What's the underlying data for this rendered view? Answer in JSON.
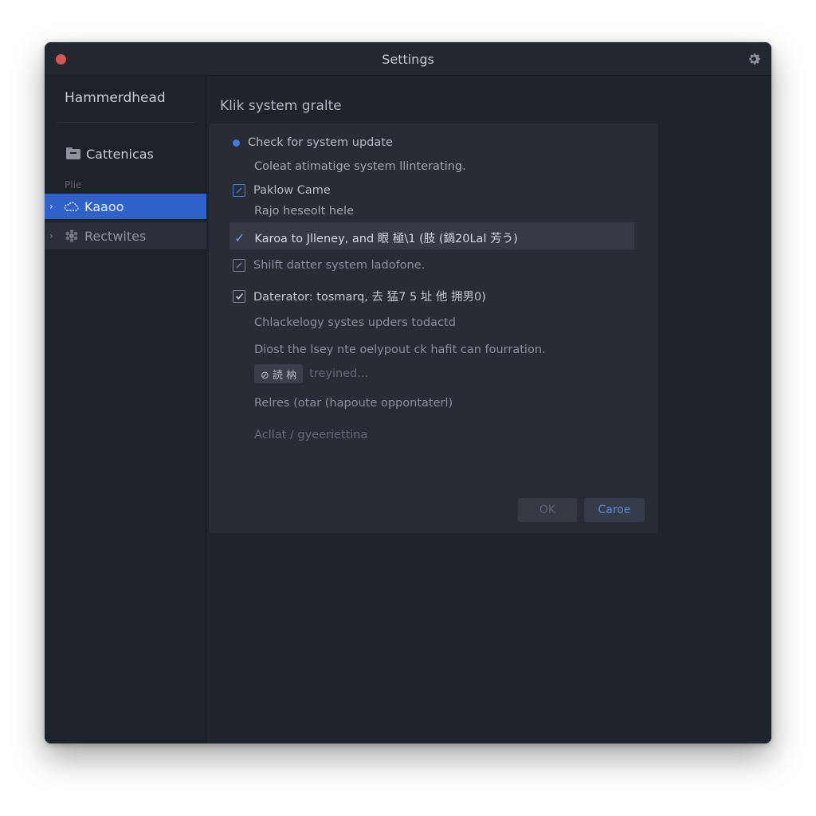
{
  "window": {
    "title": "Settings"
  },
  "sidebar": {
    "brand": "Hammerdhead",
    "category": "Cattenicas",
    "small_label": "Plie",
    "items": [
      {
        "label": "Kaaoo",
        "active": true
      },
      {
        "label": "Rectwites",
        "active": false
      }
    ]
  },
  "main": {
    "heading": "Klik system gralte",
    "rows": [
      {
        "text": "Check for system update",
        "marker": "dot"
      },
      {
        "text": "Coleat atimatige system llinterating."
      },
      {
        "text": "Paklow Came",
        "marker": "checkbox-blue"
      },
      {
        "text": "Rajo heseolt hele"
      },
      {
        "text": "Karoa to Jlleney, and 眼 極\\1 (肢 (鍋20Lal 芳う)",
        "marker": "tick",
        "selected": true
      },
      {
        "text": "Shilft datter system ladofone.",
        "marker": "checkbox"
      },
      {
        "text": "Daterator: tosmarq, 去 猛7 5 址 他 拥男0)",
        "marker": "checkbox-checked"
      },
      {
        "text": "Chlackelogy systes upders todactd"
      },
      {
        "text": "Diost the lsey nte oelypout ck hafit can fourration."
      },
      {
        "chip": "⊘ 読 枘",
        "text": "treyined..."
      },
      {
        "text": "Relres (otar (hapoute oppontaterl)"
      },
      {
        "text": "Acllat / gyeeriettina"
      }
    ],
    "ok_label": "OK",
    "cancel_label": "Caroe"
  },
  "colors": {
    "window_bg": "#1f232c",
    "accent": "#2f62c8",
    "close_dot": "#d5574f"
  },
  "icons": {
    "close": "close-dot-icon",
    "settings": "gear-icon",
    "category": "folder-icon",
    "active_item": "dashed-cloud-icon",
    "next_item": "flower-icon"
  }
}
